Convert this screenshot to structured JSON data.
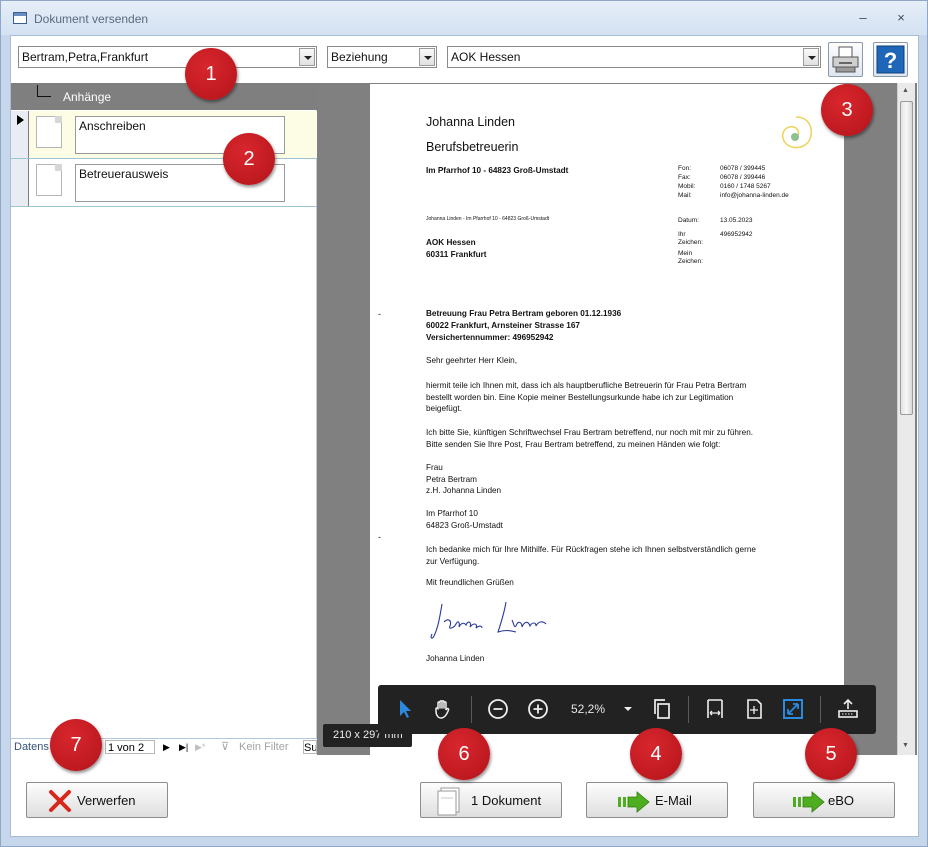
{
  "window": {
    "title": "Dokument versenden",
    "minimize": "–",
    "close": "×"
  },
  "top": {
    "contact": "Bertram,Petra,Frankfurt",
    "relation": "Beziehung",
    "recipient": "AOK Hessen"
  },
  "attachments": {
    "header": "Anhänge",
    "items": [
      "Anschreiben",
      "Betreuerausweis"
    ]
  },
  "nav": {
    "record_label": "Datens",
    "position": "1 von 2",
    "filter": "Kein Filter",
    "search": "Su"
  },
  "letter": {
    "sender_name": "Johanna Linden",
    "sender_title": "Berufsbetreuerin",
    "sender_address": "Im Pfarrhof 10 - 64823 Groß-Umstadt",
    "return_line": "Johanna Linden  -  Im Pfarrhof 10  -  64823 Groß-Umstadt",
    "contact": [
      {
        "k": "Fon:",
        "v": "06078 / 399445"
      },
      {
        "k": "Fax:",
        "v": "06078 / 399446"
      },
      {
        "k": "Mobil:",
        "v": "0160 / 1748 5267"
      },
      {
        "k": "Mail:",
        "v": "info@johanna-linden.de"
      }
    ],
    "date_label": "Datum:",
    "date_value": "13.05.2023",
    "ref_label_1": "Ihr",
    "ref_label_2": "Zeichen:",
    "ref_value": "496952942",
    "my_label_1": "Mein",
    "my_label_2": "Zeichen:",
    "recipient_line1": "AOK Hessen",
    "recipient_line2": "60311 Frankfurt",
    "subject_1": "Betreuung Frau Petra Bertram geboren 01.12.1936",
    "subject_2": "60022 Frankfurt, Arnsteiner Strasse 167",
    "subject_3": "Versichertennummer: 496952942",
    "greeting": "Sehr geehrter Herr Klein,",
    "p1_1": "hiermit teile ich Ihnen mit, dass ich als hauptberufliche Betreuerin für Frau Petra Bertram",
    "p1_2": "bestellt worden bin. Eine Kopie meiner Bestellungsurkunde habe ich zur Legitimation",
    "p1_3": "beigefügt.",
    "p2_1": "Ich bitte Sie, künftigen Schriftwechsel Frau Bertram betreffend, nur noch mit mir zu führen.",
    "p2_2": "Bitte senden Sie Ihre Post, Frau Bertram betreffend, zu meinen Händen wie folgt:",
    "addr_1": "Frau",
    "addr_2": "Petra Bertram",
    "addr_3": "z.H. Johanna Linden",
    "addr_4": "Im Pfarrhof 10",
    "addr_5": "64823 Groß-Umstadt",
    "p3_1": "Ich bedanke mich für Ihre Mithilfe. Für Rückfragen stehe ich Ihnen selbstverständlich gerne",
    "p3_2": "zur Verfügung.",
    "closing": "Mit freundlichen Grüßen",
    "signature_name": "Johanna Linden",
    "margin_mark": "-"
  },
  "viewer": {
    "zoom": "52,2%",
    "page_size": "210 x 297 mm",
    "icons": [
      "select-arrow-icon",
      "pan-hand-icon",
      "zoom-out-icon",
      "zoom-in-icon",
      "copy-pages-icon",
      "fit-width-icon",
      "fit-page-icon",
      "fullscreen-icon",
      "upload-icon"
    ]
  },
  "buttons": {
    "discard": "Verwerfen",
    "documents": "1 Dokument",
    "email": "E-Mail",
    "ebo": "eBO"
  },
  "callouts": [
    "1",
    "2",
    "3",
    "4",
    "5",
    "6",
    "7"
  ],
  "colors": {
    "callout": "#c41c23",
    "toolbar": "#222222",
    "accent": "#2a8ae0",
    "discard_x": "#d9261c",
    "send_arrow": "#4fae1f"
  }
}
